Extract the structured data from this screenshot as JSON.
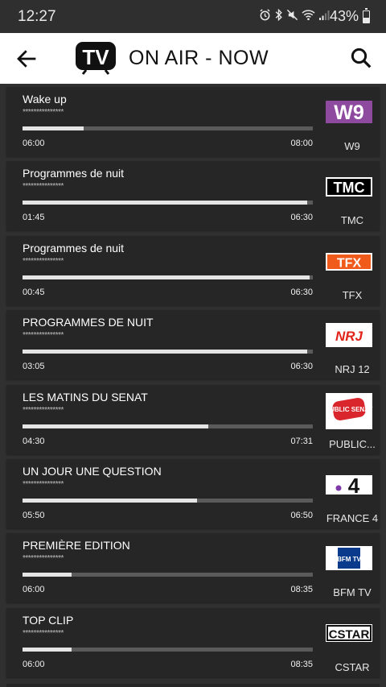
{
  "status_bar": {
    "time": "12:27",
    "battery": "43%",
    "icons": [
      "alarm-icon",
      "bluetooth-icon",
      "mute-icon",
      "wifi-icon",
      "signal-icon",
      "battery-icon"
    ]
  },
  "app_bar": {
    "logo_text": "TV",
    "title": "ON AIR - NOW"
  },
  "programs": [
    {
      "title": "Wake up",
      "subtitle": "***************",
      "start": "06:00",
      "end": "08:00",
      "progress": 0.21,
      "channel": "W9",
      "logo_text": "W9",
      "logo_color": "#8e4a9e"
    },
    {
      "title": "Programmes de nuit",
      "subtitle": "***************",
      "start": "01:45",
      "end": "06:30",
      "progress": 0.98,
      "channel": "TMC",
      "logo_text": "TMC",
      "logo_color": "#000000"
    },
    {
      "title": "Programmes de nuit",
      "subtitle": "***************",
      "start": "00:45",
      "end": "06:30",
      "progress": 0.99,
      "channel": "TFX",
      "logo_text": "TFX",
      "logo_color": "#f05a1a"
    },
    {
      "title": "PROGRAMMES DE NUIT",
      "subtitle": "***************",
      "start": "03:05",
      "end": "06:30",
      "progress": 0.98,
      "channel": "NRJ 12",
      "logo_text": "NRJ",
      "logo_color": "#e2231a"
    },
    {
      "title": "LES MATINS DU SENAT",
      "subtitle": "***************",
      "start": "04:30",
      "end": "07:31",
      "progress": 0.64,
      "channel": "PUBLIC...",
      "logo_text": "PUBLIC SENAT",
      "logo_color": "#d9262c"
    },
    {
      "title": "UN JOUR UNE QUESTION",
      "subtitle": "***************",
      "start": "05:50",
      "end": "06:50",
      "progress": 0.6,
      "channel": "FRANCE 4",
      "logo_text": "4",
      "logo_color": "#7d3aa8"
    },
    {
      "title": "PREMIÈRE EDITION",
      "subtitle": "***************",
      "start": "06:00",
      "end": "08:35",
      "progress": 0.17,
      "channel": "BFM TV",
      "logo_text": "BFM TV",
      "logo_color": "#0a3a8c"
    },
    {
      "title": "TOP CLIP",
      "subtitle": "***************",
      "start": "06:00",
      "end": "08:35",
      "progress": 0.17,
      "channel": "CSTAR",
      "logo_text": "CSTAR",
      "logo_color": "#111111"
    }
  ]
}
